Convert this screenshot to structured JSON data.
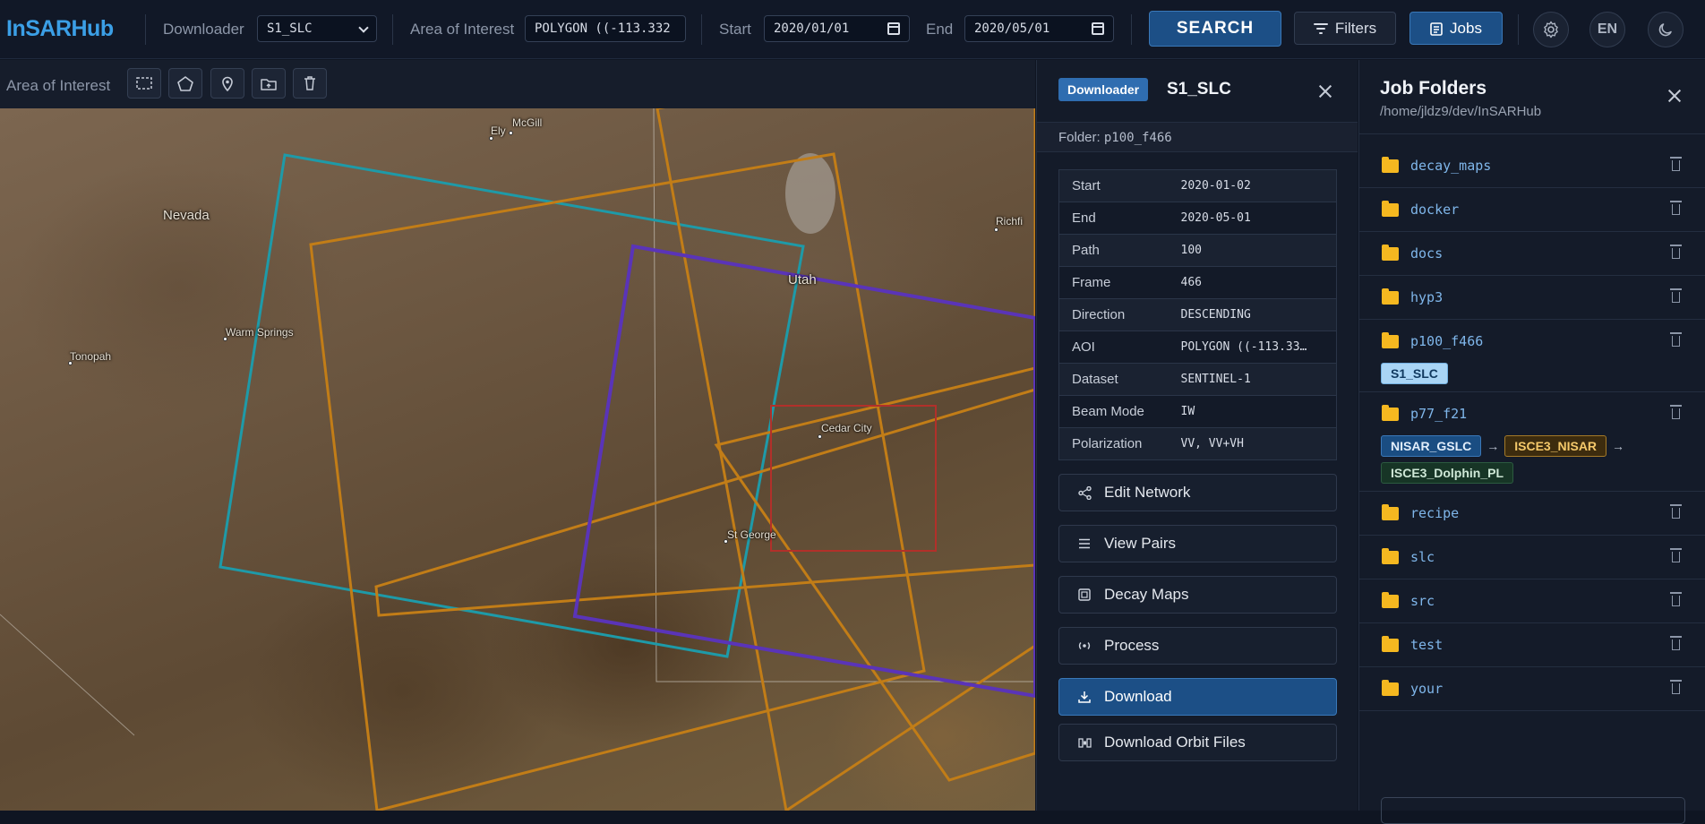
{
  "app": {
    "title": "InSARHub"
  },
  "topbar": {
    "downloader_label": "Downloader",
    "downloader_value": "S1_SLC",
    "aoi_label": "Area of Interest",
    "aoi_value": "POLYGON ((-113.332",
    "start_label": "Start",
    "start_value": "2020/01/01",
    "end_label": "End",
    "end_value": "2020/05/01",
    "search_label": "SEARCH",
    "filters_label": "Filters",
    "jobs_label": "Jobs",
    "lang_label": "EN"
  },
  "aoi_toolbar": {
    "label": "Area of Interest",
    "tools": [
      "rectangle-icon",
      "polygon-icon",
      "pin-icon",
      "folder-upload-icon",
      "trash-icon"
    ]
  },
  "map": {
    "labels": {
      "mcgill": "McGill",
      "ely": "Ely",
      "nevada": "Nevada",
      "utah": "Utah",
      "richfield": "Richfi",
      "warm_springs": "Warm Springs",
      "tonopah": "Tonopah",
      "cedar_city": "Cedar City",
      "st_george": "St George"
    },
    "colors": {
      "cyan": "#1e9aa8",
      "orange": "#c27d17",
      "purple": "#5a34b8",
      "red": "#b2302a"
    }
  },
  "detail": {
    "badge": "Downloader",
    "title": "S1_SLC",
    "folder_prefix": "Folder:",
    "folder_value": "p100_f466",
    "meta": [
      {
        "k": "Start",
        "v": "2020-01-02"
      },
      {
        "k": "End",
        "v": "2020-05-01"
      },
      {
        "k": "Path",
        "v": "100"
      },
      {
        "k": "Frame",
        "v": "466"
      },
      {
        "k": "Direction",
        "v": "DESCENDING"
      },
      {
        "k": "AOI",
        "v": "POLYGON ((-113.33…"
      },
      {
        "k": "Dataset",
        "v": "SENTINEL-1"
      },
      {
        "k": "Beam Mode",
        "v": "IW"
      },
      {
        "k": "Polarization",
        "v": "VV, VV+VH"
      }
    ],
    "actions": {
      "edit_network": "Edit Network",
      "view_pairs": "View Pairs",
      "decay_maps": "Decay Maps",
      "process": "Process",
      "download": "Download",
      "download_orbit": "Download Orbit Files"
    }
  },
  "jobs": {
    "title": "Job Folders",
    "path": "/home/jldz9/dev/InSARHub",
    "folders": [
      "decay_maps",
      "docker",
      "docs",
      "hyp3",
      "p100_f466",
      "p77_f21",
      "recipe",
      "slc",
      "src",
      "test",
      "your"
    ],
    "p100_tags": [
      "S1_SLC"
    ],
    "p77_tags": [
      "NISAR_GSLC",
      "ISCE3_NISAR",
      "ISCE3_Dolphin_PL"
    ],
    "arrow": "→"
  }
}
